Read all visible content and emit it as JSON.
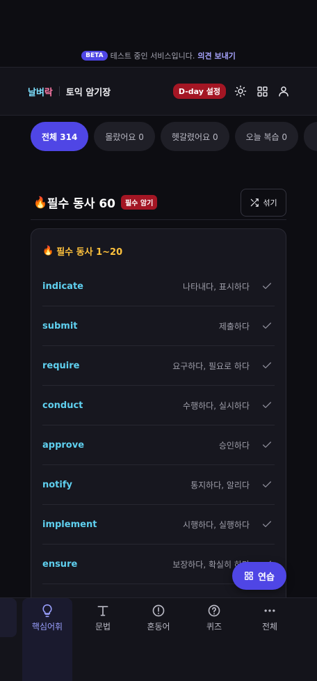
{
  "banner": {
    "badge": "BETA",
    "text": "테스트 중인 서비스입니다.",
    "link": "의견 보내기"
  },
  "header": {
    "logo_main": "날벼",
    "logo_accent": "락",
    "title": "토익 암기장",
    "dday_label": "D-day 설정",
    "icons": [
      "sun-icon",
      "grid-icon",
      "user-icon"
    ]
  },
  "tabs": [
    {
      "label": "전체 314",
      "active": true
    },
    {
      "label": "몰랐어요 0",
      "active": false
    },
    {
      "label": "헷갈렸어요 0",
      "active": false
    },
    {
      "label": "오늘 복습 0",
      "active": false
    }
  ],
  "section": {
    "emoji": "🔥",
    "title": "필수 동사 60",
    "badge": "필수 암기",
    "shuffle_label": "섞기"
  },
  "card": {
    "emoji": "🔥",
    "title": "필수 동사 1~20",
    "words": [
      {
        "en": "indicate",
        "ko": "나타내다, 표시하다"
      },
      {
        "en": "submit",
        "ko": "제출하다"
      },
      {
        "en": "require",
        "ko": "요구하다, 필요로 하다"
      },
      {
        "en": "conduct",
        "ko": "수행하다, 실시하다"
      },
      {
        "en": "approve",
        "ko": "승인하다"
      },
      {
        "en": "notify",
        "ko": "통지하다, 알리다"
      },
      {
        "en": "implement",
        "ko": "시행하다, 실행하다"
      },
      {
        "en": "ensure",
        "ko": "보장하다, 확실히 하다"
      }
    ]
  },
  "practice_label": "연습",
  "nav": [
    {
      "label": "핵심어휘",
      "icon": "lightbulb-icon",
      "active": true
    },
    {
      "label": "문법",
      "icon": "text-icon",
      "active": false
    },
    {
      "label": "혼동어",
      "icon": "alert-circle-icon",
      "active": false
    },
    {
      "label": "퀴즈",
      "icon": "help-circle-icon",
      "active": false
    },
    {
      "label": "전체",
      "icon": "more-icon",
      "active": false
    }
  ],
  "colors": {
    "accent": "#4f46e5",
    "danger": "#a41624",
    "word": "#5fd0ef",
    "card_title": "#ffc23d"
  }
}
